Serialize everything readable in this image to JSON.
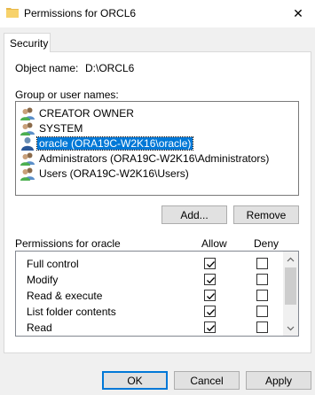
{
  "window": {
    "title": "Permissions for ORCL6",
    "close_glyph": "✕"
  },
  "tabs": [
    {
      "label": "Security",
      "active": true
    }
  ],
  "object": {
    "label": "Object name:",
    "value": "D:\\ORCL6"
  },
  "groups": {
    "label": "Group or user names:",
    "items": [
      {
        "name": "CREATOR OWNER",
        "icon": "group-users-icon",
        "selected": false
      },
      {
        "name": "SYSTEM",
        "icon": "group-users-icon",
        "selected": false
      },
      {
        "name": "oracle (ORA19C-W2K16\\oracle)",
        "icon": "single-user-icon",
        "selected": true
      },
      {
        "name": "Administrators (ORA19C-W2K16\\Administrators)",
        "icon": "group-users-icon",
        "selected": false
      },
      {
        "name": "Users (ORA19C-W2K16\\Users)",
        "icon": "group-users-icon",
        "selected": false
      }
    ]
  },
  "group_buttons": {
    "add": "Add...",
    "remove": "Remove"
  },
  "permissions": {
    "label": "Permissions for oracle",
    "allow_header": "Allow",
    "deny_header": "Deny",
    "rows": [
      {
        "name": "Full control",
        "allow": true,
        "deny": false
      },
      {
        "name": "Modify",
        "allow": true,
        "deny": false
      },
      {
        "name": "Read & execute",
        "allow": true,
        "deny": false
      },
      {
        "name": "List folder contents",
        "allow": true,
        "deny": false
      },
      {
        "name": "Read",
        "allow": true,
        "deny": false
      }
    ]
  },
  "dialog_buttons": {
    "ok": "OK",
    "cancel": "Cancel",
    "apply": "Apply"
  },
  "colors": {
    "selection": "#0078d7",
    "background": "#f0f0f0",
    "panel": "#ffffff"
  }
}
